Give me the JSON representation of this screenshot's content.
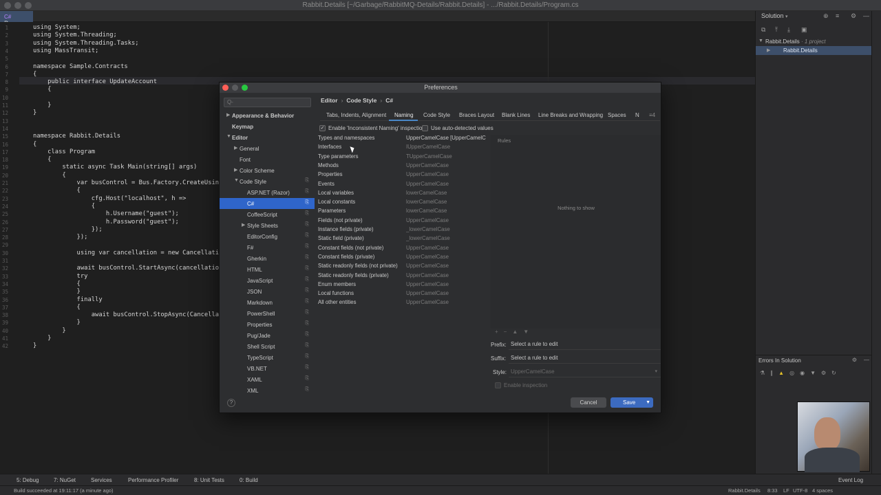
{
  "window": {
    "title": "Rabbit.Details [~/Garbage/RabbitMQ-Details/Rabbit.Details] - .../Rabbit.Details/Program.cs"
  },
  "editor_tab": {
    "lang": "C#",
    "label": "Program"
  },
  "code": {
    "lines": [
      {
        "n": "1",
        "text": "using System;"
      },
      {
        "n": "2",
        "text": "using System.Threading;"
      },
      {
        "n": "3",
        "text": "using System.Threading.Tasks;"
      },
      {
        "n": "4",
        "text": "using MassTransit;"
      },
      {
        "n": "5",
        "text": ""
      },
      {
        "n": "6",
        "text": "namespace Sample.Contracts"
      },
      {
        "n": "7",
        "text": "{"
      },
      {
        "n": "8",
        "text": "    public interface UpdateAccount"
      },
      {
        "n": "9",
        "text": "    {"
      },
      {
        "n": "10",
        "text": ""
      },
      {
        "n": "11",
        "text": "    }"
      },
      {
        "n": "12",
        "text": "}"
      },
      {
        "n": "13",
        "text": ""
      },
      {
        "n": "14",
        "text": ""
      },
      {
        "n": "15",
        "text": "namespace Rabbit.Details"
      },
      {
        "n": "16",
        "text": "{"
      },
      {
        "n": "17",
        "text": "    class Program"
      },
      {
        "n": "18",
        "text": "    {"
      },
      {
        "n": "19",
        "text": "        static async Task Main(string[] args)"
      },
      {
        "n": "20",
        "text": "        {"
      },
      {
        "n": "21",
        "text": "            var busControl = Bus.Factory.CreateUsingRabbit"
      },
      {
        "n": "22",
        "text": "            {"
      },
      {
        "n": "23",
        "text": "                cfg.Host(\"localhost\", h =>"
      },
      {
        "n": "24",
        "text": "                {"
      },
      {
        "n": "25",
        "text": "                    h.Username(\"guest\");"
      },
      {
        "n": "26",
        "text": "                    h.Password(\"guest\");"
      },
      {
        "n": "27",
        "text": "                });"
      },
      {
        "n": "28",
        "text": "            });"
      },
      {
        "n": "29",
        "text": ""
      },
      {
        "n": "30",
        "text": "            using var cancellation = new CancellationToke"
      },
      {
        "n": "31",
        "text": ""
      },
      {
        "n": "32",
        "text": "            await busControl.StartAsync(cancellation.Toker"
      },
      {
        "n": "33",
        "text": "            try"
      },
      {
        "n": "34",
        "text": "            {"
      },
      {
        "n": "35",
        "text": "            }"
      },
      {
        "n": "36",
        "text": "            finally"
      },
      {
        "n": "37",
        "text": "            {"
      },
      {
        "n": "38",
        "text": "                await busControl.StopAsync(CancellationTok"
      },
      {
        "n": "39",
        "text": "            }"
      },
      {
        "n": "40",
        "text": "        }"
      },
      {
        "n": "41",
        "text": "    }"
      },
      {
        "n": "42",
        "text": "}"
      }
    ]
  },
  "solution_panel": {
    "title": "Solution",
    "items": [
      {
        "label": "Rabbit.Details",
        "note": "· 1 project"
      },
      {
        "label": "Rabbit.Details",
        "note": ""
      }
    ],
    "errors_title": "Errors In Solution"
  },
  "dialog": {
    "title": "Preferences",
    "search_placeholder": "Q-",
    "breadcrumb": [
      "Editor",
      "Code Style",
      "C#"
    ],
    "nav": [
      {
        "label": "Appearance & Behavior",
        "arrow": "▶",
        "bold": true,
        "indent": 1,
        "cfg": false
      },
      {
        "label": "Keymap",
        "arrow": "",
        "bold": true,
        "indent": 1,
        "cfg": false
      },
      {
        "label": "Editor",
        "arrow": "▼",
        "bold": true,
        "indent": 1,
        "cfg": false
      },
      {
        "label": "General",
        "arrow": "▶",
        "bold": false,
        "indent": 2,
        "cfg": false
      },
      {
        "label": "Font",
        "arrow": "",
        "bold": false,
        "indent": 2,
        "cfg": false
      },
      {
        "label": "Color Scheme",
        "arrow": "▶",
        "bold": false,
        "indent": 2,
        "cfg": false
      },
      {
        "label": "Code Style",
        "arrow": "▼",
        "bold": false,
        "indent": 2,
        "cfg": true
      },
      {
        "label": "ASP.NET (Razor)",
        "arrow": "",
        "bold": false,
        "indent": 3,
        "cfg": true
      },
      {
        "label": "C#",
        "arrow": "",
        "bold": false,
        "indent": 3,
        "cfg": true,
        "selected": true
      },
      {
        "label": "CoffeeScript",
        "arrow": "",
        "bold": false,
        "indent": 3,
        "cfg": true
      },
      {
        "label": "Style Sheets",
        "arrow": "▶",
        "bold": false,
        "indent": 3,
        "cfg": true
      },
      {
        "label": "EditorConfig",
        "arrow": "",
        "bold": false,
        "indent": 3,
        "cfg": true
      },
      {
        "label": "F#",
        "arrow": "",
        "bold": false,
        "indent": 3,
        "cfg": true
      },
      {
        "label": "Gherkin",
        "arrow": "",
        "bold": false,
        "indent": 3,
        "cfg": true
      },
      {
        "label": "HTML",
        "arrow": "",
        "bold": false,
        "indent": 3,
        "cfg": true
      },
      {
        "label": "JavaScript",
        "arrow": "",
        "bold": false,
        "indent": 3,
        "cfg": true
      },
      {
        "label": "JSON",
        "arrow": "",
        "bold": false,
        "indent": 3,
        "cfg": true
      },
      {
        "label": "Markdown",
        "arrow": "",
        "bold": false,
        "indent": 3,
        "cfg": true
      },
      {
        "label": "PowerShell",
        "arrow": "",
        "bold": false,
        "indent": 3,
        "cfg": true
      },
      {
        "label": "Properties",
        "arrow": "",
        "bold": false,
        "indent": 3,
        "cfg": true
      },
      {
        "label": "Pug/Jade",
        "arrow": "",
        "bold": false,
        "indent": 3,
        "cfg": true
      },
      {
        "label": "Shell Script",
        "arrow": "",
        "bold": false,
        "indent": 3,
        "cfg": true
      },
      {
        "label": "TypeScript",
        "arrow": "",
        "bold": false,
        "indent": 3,
        "cfg": true
      },
      {
        "label": "VB.NET",
        "arrow": "",
        "bold": false,
        "indent": 3,
        "cfg": true
      },
      {
        "label": "XAML",
        "arrow": "",
        "bold": false,
        "indent": 3,
        "cfg": true
      },
      {
        "label": "XML",
        "arrow": "",
        "bold": false,
        "indent": 3,
        "cfg": true
      }
    ],
    "subtabs": [
      "Tabs, Indents, Alignment",
      "Naming",
      "Code Style",
      "Braces Layout",
      "Blank Lines",
      "Line Breaks and Wrapping",
      "Spaces",
      "N"
    ],
    "subtabs_overflow": "≡4",
    "enable_inspection_label": "Enable 'Inconsistent Naming' inspection",
    "auto_detected_label": "Use auto-detected values",
    "naming_rows": [
      {
        "kind": "Types and namespaces",
        "style": "UpperCamelCase [UpperCamelC..."
      },
      {
        "kind": "Interfaces",
        "style": "IUpperCamelCase"
      },
      {
        "kind": "Type parameters",
        "style": "TUpperCamelCase"
      },
      {
        "kind": "Methods",
        "style": "UpperCamelCase"
      },
      {
        "kind": "Properties",
        "style": "UpperCamelCase"
      },
      {
        "kind": "Events",
        "style": "UpperCamelCase"
      },
      {
        "kind": "Local variables",
        "style": "lowerCamelCase"
      },
      {
        "kind": "Local constants",
        "style": "lowerCamelCase"
      },
      {
        "kind": "Parameters",
        "style": "lowerCamelCase"
      },
      {
        "kind": "Fields (not private)",
        "style": "UpperCamelCase"
      },
      {
        "kind": "Instance fields (private)",
        "style": "_lowerCamelCase"
      },
      {
        "kind": "Static field (private)",
        "style": "_lowerCamelCase"
      },
      {
        "kind": "Constant fields (not private)",
        "style": "UpperCamelCase"
      },
      {
        "kind": "Constant fields (private)",
        "style": "UpperCamelCase"
      },
      {
        "kind": "Static readonly fields (not private)",
        "style": "UpperCamelCase"
      },
      {
        "kind": "Static readonly fields (private)",
        "style": "UpperCamelCase"
      },
      {
        "kind": "Enum members",
        "style": "UpperCamelCase"
      },
      {
        "kind": "Local functions",
        "style": "UpperCamelCase"
      },
      {
        "kind": "All other entities",
        "style": "UpperCamelCase"
      }
    ],
    "rules_header": "Rules",
    "rules_empty": "Nothing to show",
    "prefix_label": "Prefix:",
    "prefix_value": "Select a rule to edit",
    "suffix_label": "Suffix:",
    "suffix_value": "Select a rule to edit",
    "style_label": "Style:",
    "style_value": "UpperCamelCase",
    "enable_inspection_small": "Enable inspection",
    "help": "?",
    "cancel": "Cancel",
    "save": "Save"
  },
  "toolstrip": {
    "items": [
      "5: Debug",
      "7: NuGet",
      "Services",
      "Performance Profiler",
      "8: Unit Tests",
      "0: Build"
    ],
    "event_log": "Event Log"
  },
  "statusbar": {
    "left": "Build succeeded at 19:11:17 (a minute ago)",
    "project": "Rabbit.Details",
    "position": "8:33",
    "eol": "LF",
    "encoding": "UTF-8",
    "indent": "4 spaces"
  }
}
